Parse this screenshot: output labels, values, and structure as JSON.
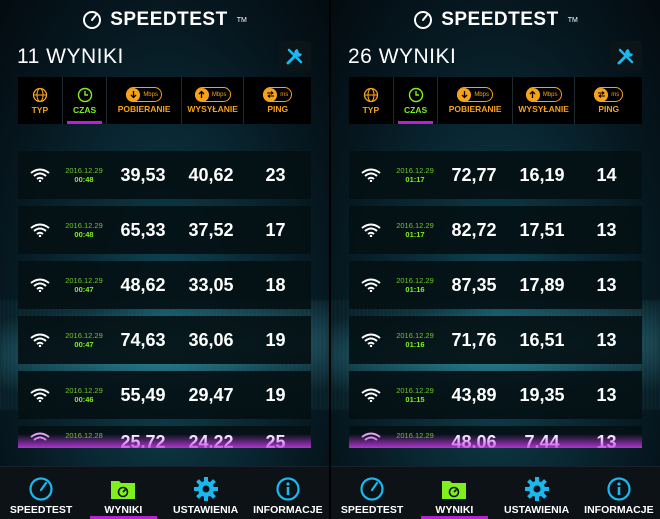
{
  "brand": {
    "name": "SPEEDTEST",
    "tm": "TM"
  },
  "panels": [
    {
      "results_count": "11 WYNIKI",
      "headers": {
        "typ": "TYP",
        "czas": "CZAS",
        "pobieranie": "POBIERANIE",
        "wysylanie": "WYSYŁANIE",
        "ping": "PING",
        "unit_speed": "Mbps",
        "unit_ping": "ms"
      },
      "rows": [
        {
          "date": "2016.12.29",
          "time": "00:48",
          "down": "39,53",
          "up": "40,62",
          "ping": "23"
        },
        {
          "date": "2016.12.29",
          "time": "00:48",
          "down": "65,33",
          "up": "37,52",
          "ping": "17"
        },
        {
          "date": "2016.12.29",
          "time": "00:47",
          "down": "48,62",
          "up": "33,05",
          "ping": "18"
        },
        {
          "date": "2016.12.29",
          "time": "00:47",
          "down": "74,63",
          "up": "36,06",
          "ping": "19"
        },
        {
          "date": "2016.12.29",
          "time": "00:46",
          "down": "55,49",
          "up": "29,47",
          "ping": "19"
        }
      ],
      "partial_row": {
        "date": "2016.12.28",
        "down": "25,72",
        "up": "24,22",
        "ping": "25"
      },
      "nav": [
        "SPEEDTEST",
        "WYNIKI",
        "USTAWIENIA",
        "INFORMACJE"
      ]
    },
    {
      "results_count": "26 WYNIKI",
      "headers": {
        "typ": "TYP",
        "czas": "CZAS",
        "pobieranie": "POBIERANIE",
        "wysylanie": "WYSYŁANIE",
        "ping": "PING",
        "unit_speed": "Mbps",
        "unit_ping": "ms"
      },
      "rows": [
        {
          "date": "2016.12.29",
          "time": "01:17",
          "down": "72,77",
          "up": "16,19",
          "ping": "14"
        },
        {
          "date": "2016.12.29",
          "time": "01:17",
          "down": "82,72",
          "up": "17,51",
          "ping": "13"
        },
        {
          "date": "2016.12.29",
          "time": "01:16",
          "down": "87,35",
          "up": "17,89",
          "ping": "13"
        },
        {
          "date": "2016.12.29",
          "time": "01:16",
          "down": "71,76",
          "up": "16,51",
          "ping": "13"
        },
        {
          "date": "2016.12.29",
          "time": "01:15",
          "down": "43,89",
          "up": "19,35",
          "ping": "13"
        }
      ],
      "partial_row": {
        "date": "2016.12.29",
        "down": "48,06",
        "up": "7,44",
        "ping": "13"
      },
      "nav": [
        "SPEEDTEST",
        "WYNIKI",
        "USTAWIENIA",
        "INFORMACJE"
      ]
    }
  ],
  "colors": {
    "accent_orange": "#f7a21b",
    "accent_green": "#7ff01e",
    "accent_purple": "#b81fd6",
    "icon_cyan": "#19b8ee"
  }
}
